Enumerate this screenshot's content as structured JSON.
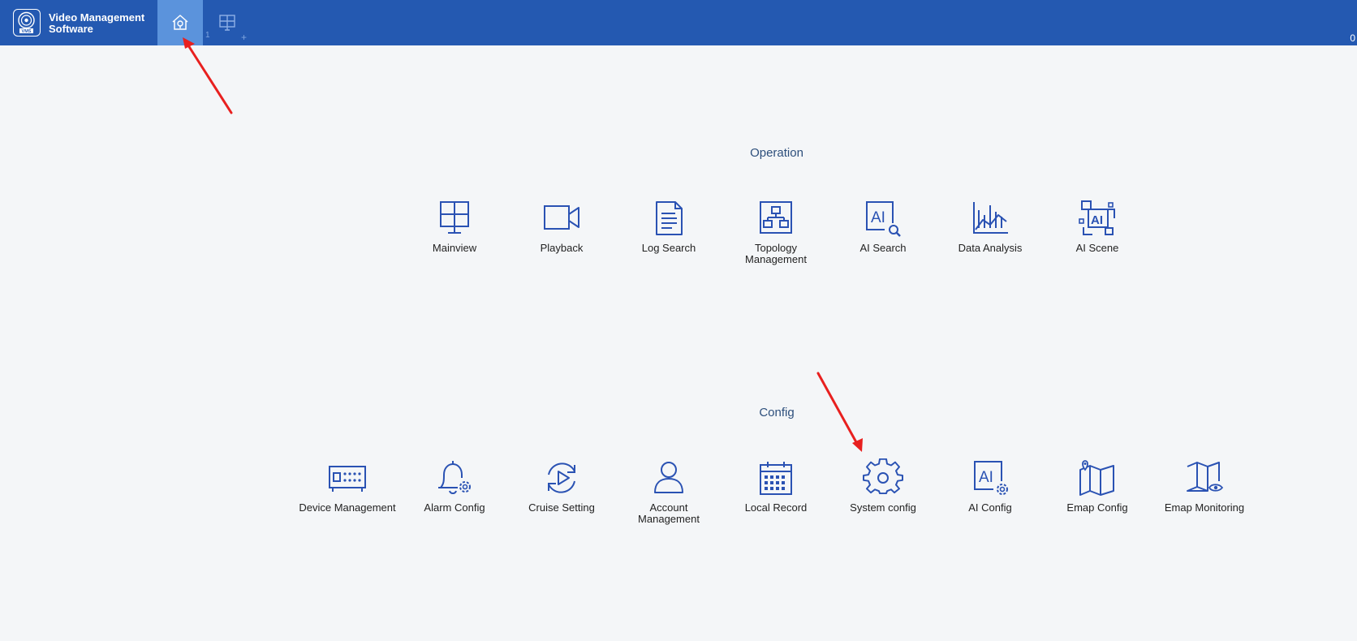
{
  "header": {
    "app_title": "Video Management Software",
    "logo_text": "VMS",
    "tab_index": "1",
    "tab_add": "+",
    "corner_value": "0"
  },
  "sections": {
    "operation": {
      "title": "Operation",
      "items": [
        {
          "label": "Mainview",
          "icon": "mainview-icon"
        },
        {
          "label": "Playback",
          "icon": "playback-icon"
        },
        {
          "label": "Log Search",
          "icon": "log-search-icon"
        },
        {
          "label": "Topology Management",
          "icon": "topology-icon"
        },
        {
          "label": "AI Search",
          "icon": "ai-search-icon"
        },
        {
          "label": "Data Analysis",
          "icon": "data-analysis-icon"
        },
        {
          "label": "AI Scene",
          "icon": "ai-scene-icon"
        }
      ]
    },
    "config": {
      "title": "Config",
      "items": [
        {
          "label": "Device Management",
          "icon": "device-icon"
        },
        {
          "label": "Alarm Config",
          "icon": "alarm-icon"
        },
        {
          "label": "Cruise Setting",
          "icon": "cruise-icon"
        },
        {
          "label": "Account Management",
          "icon": "account-icon"
        },
        {
          "label": "Local Record",
          "icon": "calendar-icon"
        },
        {
          "label": "System config",
          "icon": "gear-icon"
        },
        {
          "label": "AI Config",
          "icon": "ai-config-icon"
        },
        {
          "label": "Emap Config",
          "icon": "emap-config-icon"
        },
        {
          "label": "Emap Monitoring",
          "icon": "emap-monitoring-icon"
        }
      ]
    }
  },
  "colors": {
    "header_bg": "#2459b1",
    "active_tab_bg": "#5b93dc",
    "icon_stroke": "#2a52b3",
    "annotation_arrow": "#e8201f"
  }
}
